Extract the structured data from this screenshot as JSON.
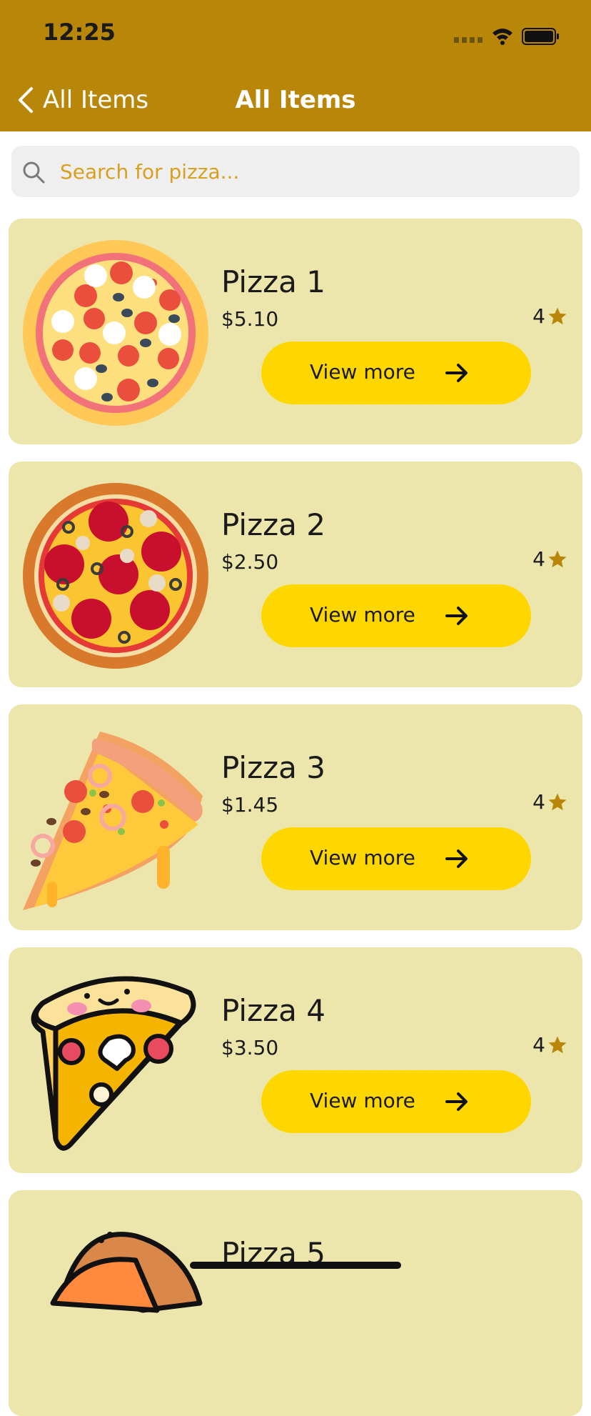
{
  "status_bar": {
    "time": "12:25"
  },
  "nav": {
    "back_label": "All Items",
    "title": "All Items"
  },
  "search": {
    "placeholder": "Search for pizza..."
  },
  "items": [
    {
      "name": "Pizza 1",
      "price": "$5.10",
      "rating": "4",
      "button": "View more"
    },
    {
      "name": "Pizza 2",
      "price": "$2.50",
      "rating": "4",
      "button": "View more"
    },
    {
      "name": "Pizza 3",
      "price": "$1.45",
      "rating": "4",
      "button": "View more"
    },
    {
      "name": "Pizza 4",
      "price": "$3.50",
      "rating": "4",
      "button": "View more"
    },
    {
      "name": "Pizza 5"
    }
  ],
  "colors": {
    "header": "#B8870A",
    "card": "#ECE6AD",
    "button": "#FFD700",
    "star": "#B8870A"
  }
}
